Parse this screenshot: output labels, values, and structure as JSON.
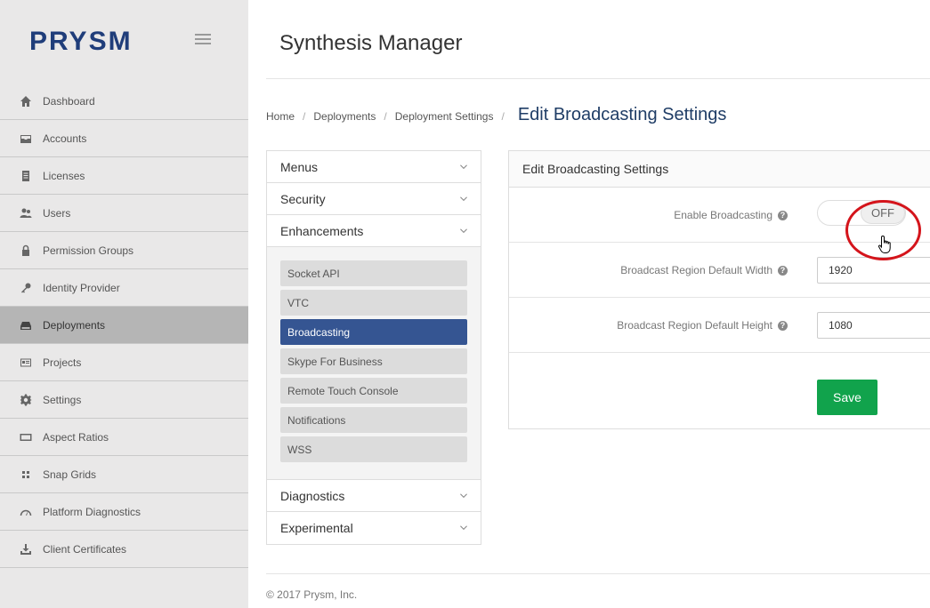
{
  "sidebar": {
    "logo": "PRYSM",
    "items": [
      {
        "label": "Dashboard",
        "icon": "home-icon"
      },
      {
        "label": "Accounts",
        "icon": "inbox-icon"
      },
      {
        "label": "Licenses",
        "icon": "document-icon"
      },
      {
        "label": "Users",
        "icon": "users-icon"
      },
      {
        "label": "Permission Groups",
        "icon": "lock-icon"
      },
      {
        "label": "Identity Provider",
        "icon": "key-icon"
      },
      {
        "label": "Deployments",
        "icon": "drive-icon",
        "active": true
      },
      {
        "label": "Projects",
        "icon": "id-card-icon"
      },
      {
        "label": "Settings",
        "icon": "gear-icon"
      },
      {
        "label": "Aspect Ratios",
        "icon": "rectangle-icon"
      },
      {
        "label": "Snap Grids",
        "icon": "grid-icon"
      },
      {
        "label": "Platform Diagnostics",
        "icon": "gauge-icon"
      },
      {
        "label": "Client Certificates",
        "icon": "download-icon"
      }
    ]
  },
  "header": {
    "title": "Synthesis Manager"
  },
  "breadcrumb": {
    "items": [
      "Home",
      "Deployments",
      "Deployment Settings"
    ],
    "current": "Edit Broadcasting Settings"
  },
  "accordion": {
    "sections_top": [
      "Menus",
      "Security",
      "Enhancements"
    ],
    "enhancements_items": [
      "Socket API",
      "VTC",
      "Broadcasting",
      "Skype For Business",
      "Remote Touch Console",
      "Notifications",
      "WSS"
    ],
    "active_item": "Broadcasting",
    "sections_bottom": [
      "Diagnostics",
      "Experimental"
    ]
  },
  "panel": {
    "title": "Edit Broadcasting Settings",
    "enable_label": "Enable Broadcasting",
    "toggle_state": "OFF",
    "width_label": "Broadcast Region Default Width",
    "width_value": "1920",
    "height_label": "Broadcast Region Default Height",
    "height_value": "1080",
    "save_label": "Save"
  },
  "footer": {
    "copyright": "© 2017 Prysm, Inc."
  },
  "colors": {
    "accent": "#355592",
    "save": "#11a34c",
    "annotation": "#d4141b"
  }
}
